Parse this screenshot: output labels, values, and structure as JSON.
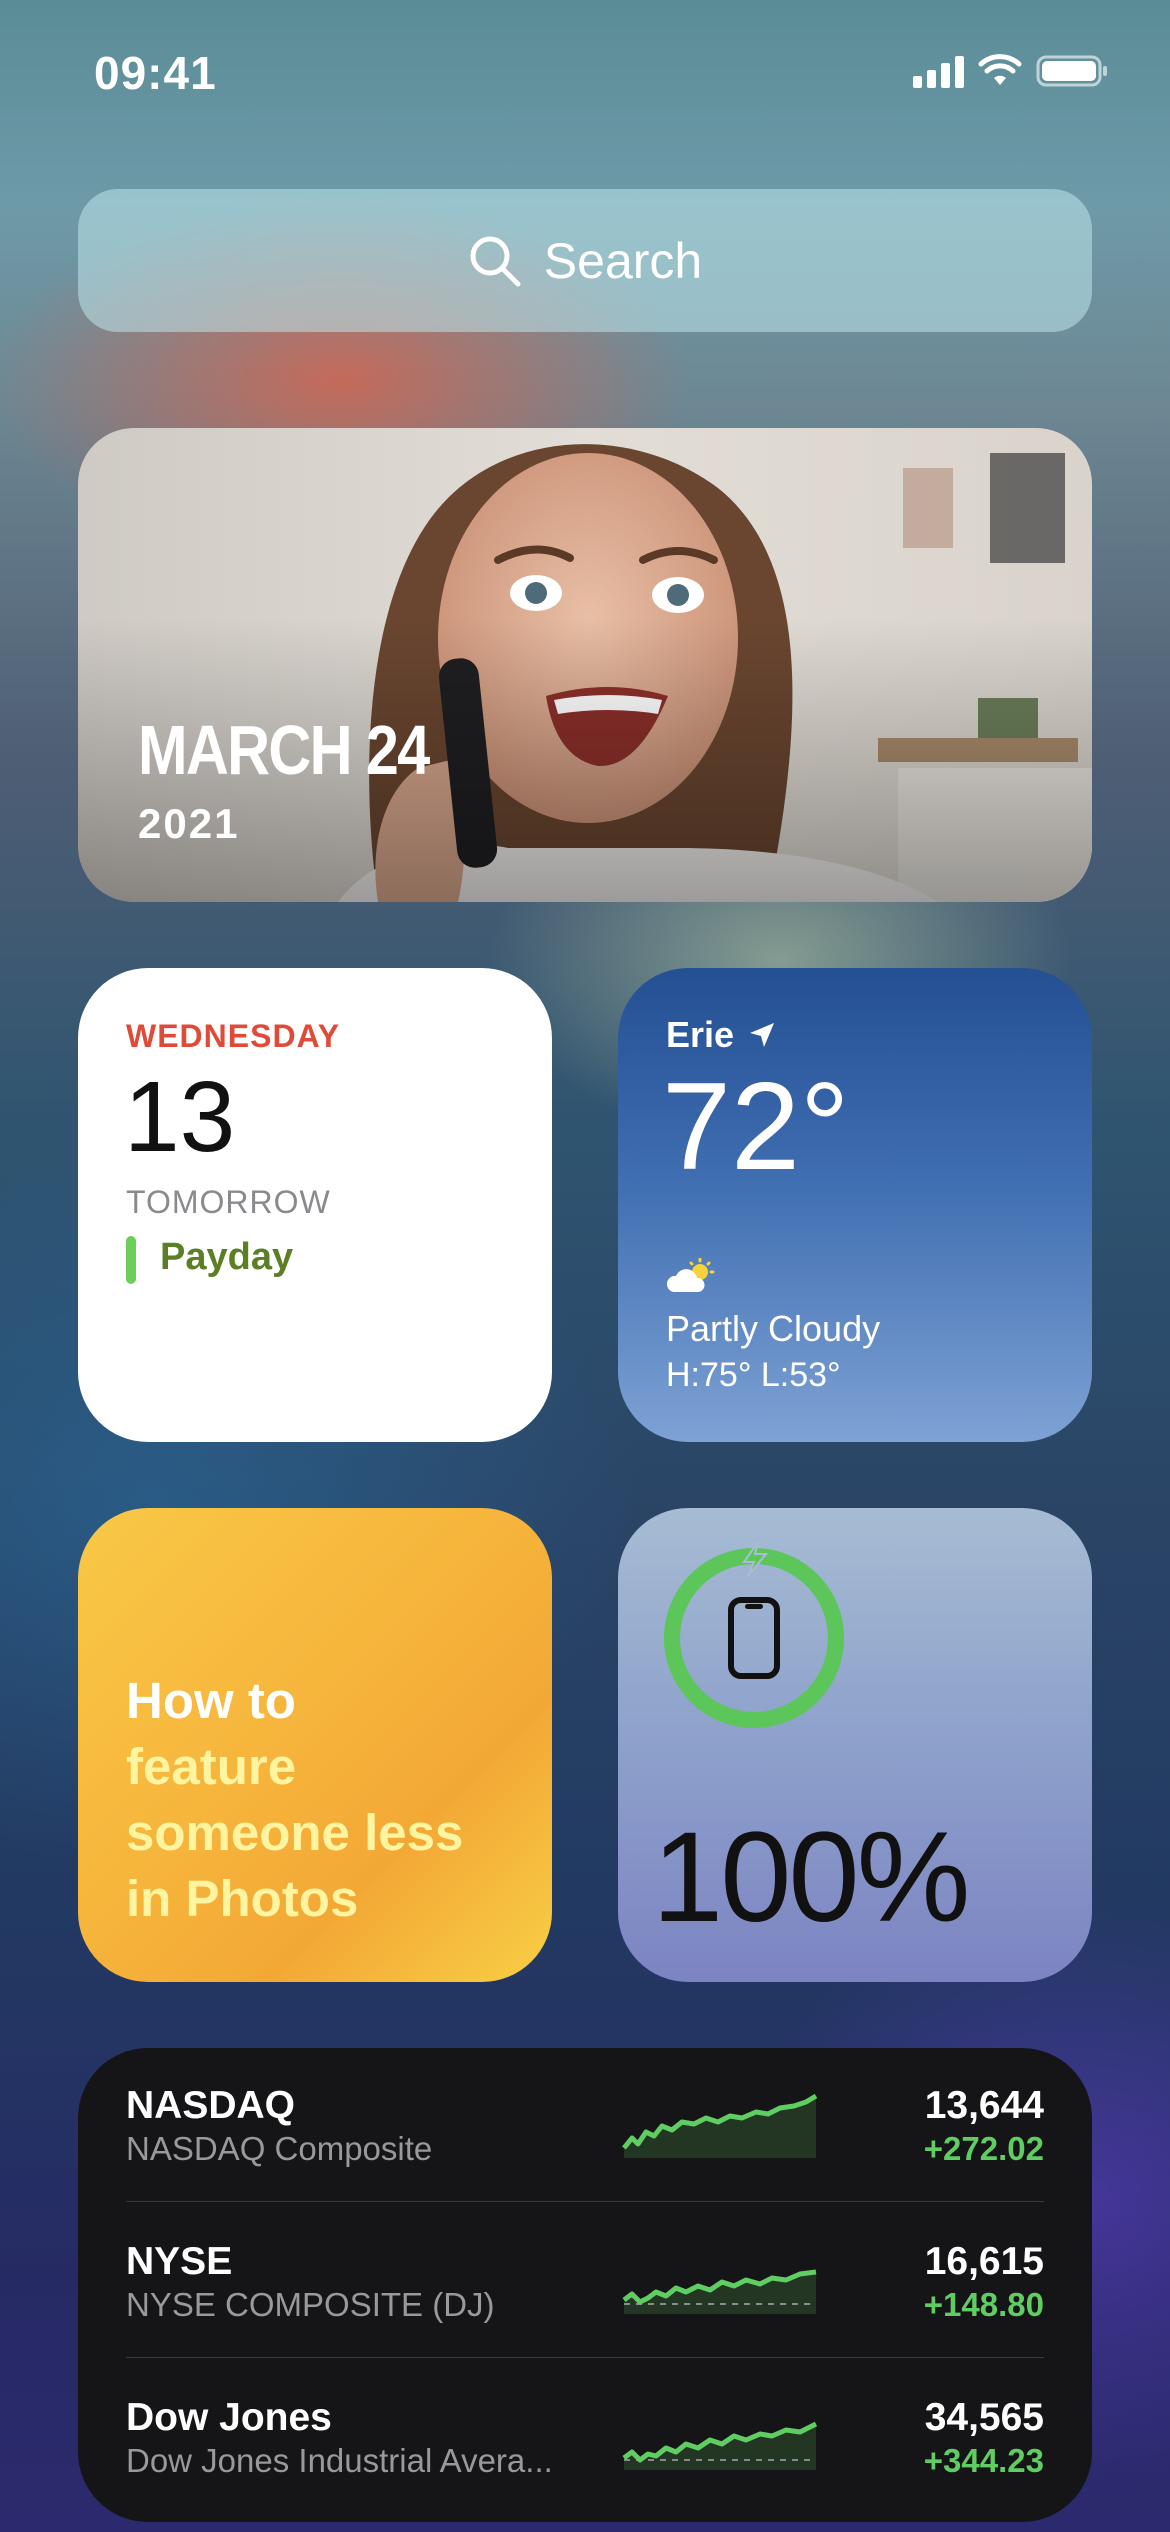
{
  "status_bar": {
    "time": "09:41"
  },
  "search": {
    "placeholder": "Search"
  },
  "photo_widget": {
    "date": "MARCH 24",
    "year": "2021"
  },
  "calendar_widget": {
    "weekday": "WEDNESDAY",
    "day": "13",
    "section": "TOMORROW",
    "event": "Payday",
    "event_color": "#6ccf5a"
  },
  "weather_widget": {
    "city": "Erie",
    "temperature": "72°",
    "condition": "Partly Cloudy",
    "hi_lo": "H:75° L:53°",
    "icon": "partly-cloudy-icon"
  },
  "tips_widget": {
    "line1": "How to",
    "highlight": "feature someone less in Photos"
  },
  "battery_widget": {
    "percent": "100%",
    "level": 1.0,
    "icon": "iphone-icon",
    "ring_color": "#5cc65a"
  },
  "stocks_widget": {
    "rows": [
      {
        "symbol": "NASDAQ",
        "name": "NASDAQ Composite",
        "price": "13,644",
        "change": "+272.02"
      },
      {
        "symbol": "NYSE",
        "name": "NYSE COMPOSITE (DJ)",
        "price": "16,615",
        "change": "+148.80"
      },
      {
        "symbol": "Dow Jones",
        "name": "Dow Jones Industrial Avera...",
        "price": "34,565",
        "change": "+344.23"
      }
    ],
    "positive_color": "#5fcd61"
  }
}
